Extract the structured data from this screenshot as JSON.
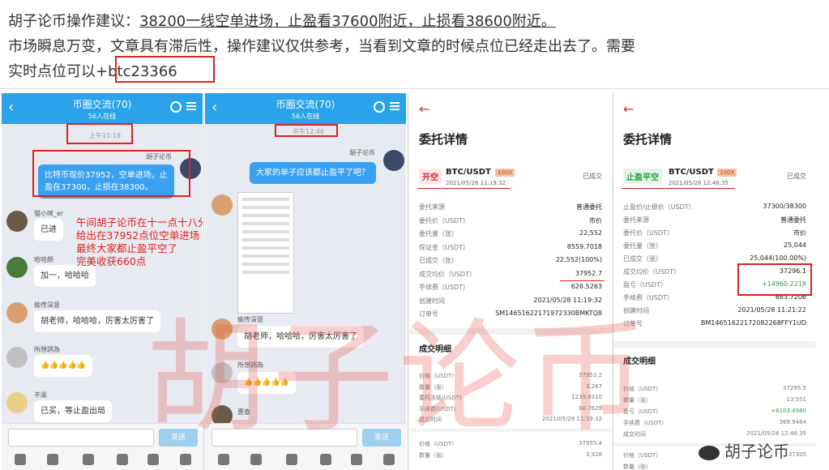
{
  "header": {
    "line1_prefix": "胡子论币操作建议：",
    "line1_rest": "38200一线空单进场，止盈看37600附近，止损看38600附近。",
    "line2": "市场瞬息万变，文章具有滞后性，操作建议仅供参考，当看到文章的时候点位已经走出去了。需要",
    "line3_prefix": "实时点位可以",
    "line3_contact": "+btc23366"
  },
  "chat1": {
    "title": "币圈交流(70)",
    "subtitle": "56人在线",
    "time": "上午11:18",
    "sender": "胡子论币",
    "my_message": "比特币现价37952，空单进场，止盈在37300，止损在38300。",
    "annotation": [
      "午间胡子论币在十一点十八分的时候",
      "给出在37952点位空单进场",
      "最终大家都止盈平空了",
      "完美收获660点"
    ],
    "messages": [
      {
        "name": "猫小咪_er",
        "text": "已进"
      },
      {
        "name": "哈哈颜",
        "text": "加一，哈哈哈"
      },
      {
        "name": "偷传深意",
        "text": "胡老师，哈哈哈，厉害太厉害了"
      },
      {
        "name": "所想詞為",
        "text": "👍👍👍👍👍"
      },
      {
        "name": "不渝",
        "text": "已买，等止盈出局"
      }
    ],
    "send_label": "发送"
  },
  "chat2": {
    "title": "币圈交流(70)",
    "subtitle": "56人在线",
    "time": "中午12:46",
    "sender": "胡子论币",
    "my_message": "大家的单子应该都止盈平了吧？",
    "messages": [
      {
        "name": "偷传深意",
        "text": "胡老师，哈哈哈，厉害太厉害了"
      },
      {
        "name": "所想詞為",
        "text": "👍👍👍👍👍"
      },
      {
        "name": "惠泰",
        "text": ""
      }
    ],
    "send_label": "发送"
  },
  "detail1": {
    "title": "委托详情",
    "tag": "开空",
    "pair": "BTC/USDT",
    "leverage": "100X",
    "date": "2021/05/28 11:19:32",
    "status": "已成交",
    "rows": [
      {
        "k": "委托来源",
        "v": "普通委托"
      },
      {
        "k": "委托价（USDT）",
        "v": "市价"
      },
      {
        "k": "委托量（张）",
        "v": "22,552"
      },
      {
        "k": "保证金（USDT）",
        "v": "8559.7018"
      },
      {
        "k": "已成交（张）",
        "v": "22,552(100%)"
      },
      {
        "k": "成交均价（USDT）",
        "v": "37952.7"
      },
      {
        "k": "手续费（USDT）",
        "v": "626.5263"
      },
      {
        "k": "创建时间",
        "v": "2021/05/28 11:19:32"
      },
      {
        "k": "订单号",
        "v": "SM14651622171972330BMKTQ8"
      }
    ],
    "section": "成交明细",
    "fills": [
      {
        "k": "价格（USDT）",
        "v": "37953.2"
      },
      {
        "k": "数量（张）",
        "v": "3,267"
      },
      {
        "k": "委托冻结(USDT)",
        "v": "1239.9310"
      },
      {
        "k": "手续费(USDT)",
        "v": "90.7629"
      },
      {
        "k": "成交时间",
        "v": "2021/05/28 11:19:32"
      }
    ],
    "fills2": [
      {
        "k": "价格（USDT）",
        "v": "37955.4"
      },
      {
        "k": "数量（张）",
        "v": "3,928"
      }
    ]
  },
  "detail2": {
    "title": "委托详情",
    "tag": "止盈平空",
    "pair": "BTC/USDT",
    "leverage": "100X",
    "date": "2021/05/28 12:46:35",
    "status": "已成交",
    "rows": [
      {
        "k": "止盈价/止损价（USDT）",
        "v": "37300/38300"
      },
      {
        "k": "委托来源",
        "v": "普通委托"
      },
      {
        "k": "委托价（USDT）",
        "v": "市价"
      },
      {
        "k": "委托量（张）",
        "v": "25,044"
      },
      {
        "k": "已成交（张）",
        "v": "25,044(100.00%)"
      },
      {
        "k": "成交均价（USDT）",
        "v": "37296.1"
      },
      {
        "k": "盈亏（USDT）",
        "v": "+14960.2218"
      },
      {
        "k": "手续费（USDT）",
        "v": "683.7206"
      },
      {
        "k": "创建时间",
        "v": "2021/05/28 11:21:22"
      },
      {
        "k": "订单号",
        "v": "BM14651622172082268FFY1UD"
      }
    ],
    "section": "成交明细",
    "fills": [
      {
        "k": "价格（USDT）",
        "v": "37295.5"
      },
      {
        "k": "数量（张）",
        "v": "13,551"
      },
      {
        "k": "盈亏（USDT）",
        "v": "+8103.4980"
      },
      {
        "k": "手续费（USDT）",
        "v": "369.9464"
      },
      {
        "k": "成交时间",
        "v": "2021/05/28 12:46:35"
      }
    ],
    "fills2": [
      {
        "k": "价格（USDT）",
        "v": "37305"
      },
      {
        "k": "数量（张）",
        "v": ""
      }
    ]
  },
  "watermark": "胡子论币",
  "weibo_tag": "胡子论币",
  "colors": {
    "accent_blue": "#2aa3ea",
    "red": "#e02020",
    "green": "#24a040"
  }
}
